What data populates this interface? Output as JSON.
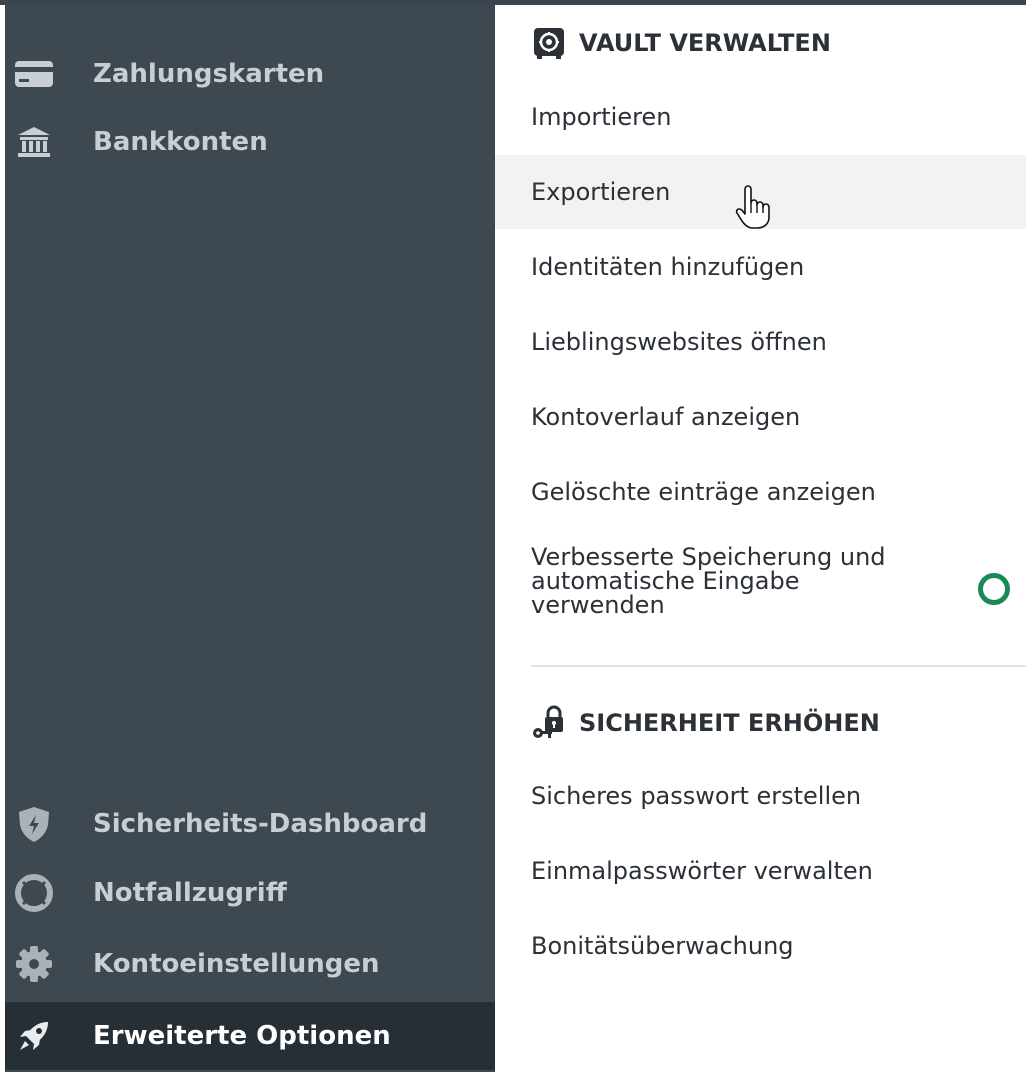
{
  "sidebar": {
    "items": [
      {
        "label": "Zahlungskarten",
        "icon": "credit-card-icon"
      },
      {
        "label": "Bankkonten",
        "icon": "bank-icon"
      },
      {
        "label": "Sicherheits-Dashboard",
        "icon": "shield-icon"
      },
      {
        "label": "Notfallzugriff",
        "icon": "lifebuoy-icon"
      },
      {
        "label": "Kontoeinstellungen",
        "icon": "gear-icon"
      },
      {
        "label": "Erweiterte Optionen",
        "icon": "rocket-icon",
        "active": true
      }
    ]
  },
  "vault": {
    "title": "VAULT VERWALTEN",
    "icon": "vault-icon",
    "items": [
      {
        "label": "Importieren"
      },
      {
        "label": "Exportieren",
        "hovered": true
      },
      {
        "label": "Identitäten hinzufügen"
      },
      {
        "label": "Lieblingswebsites öffnen"
      },
      {
        "label": "Kontoverlauf anzeigen"
      },
      {
        "label": "Gelöschte einträge anzeigen"
      }
    ],
    "toggle_option": {
      "lines": [
        "Verbesserte Speicherung und",
        "automatische Eingabe",
        "verwenden"
      ],
      "color": "#1a8a55"
    }
  },
  "security": {
    "title": "SICHERHEIT ERHÖHEN",
    "icon": "key-lock-icon",
    "items": [
      {
        "label": "Sicheres passwort erstellen"
      },
      {
        "label": "Einmalpasswörter verwalten"
      },
      {
        "label": "Bonitätsüberwachung"
      }
    ]
  },
  "colors": {
    "sidebar_bg": "#3d4851",
    "sidebar_active_bg": "#262f36",
    "accent_green": "#1a8a55"
  }
}
